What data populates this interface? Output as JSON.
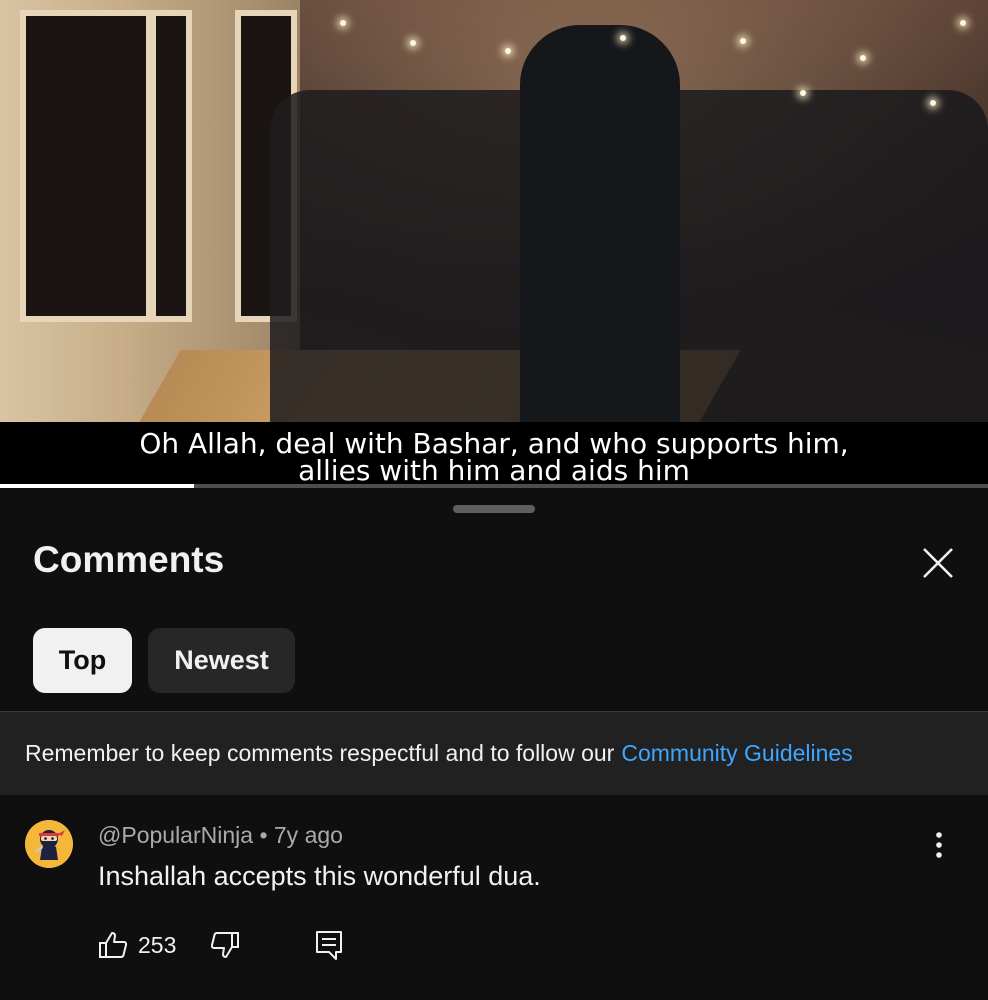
{
  "video": {
    "subtitle_line1": "Oh Allah, deal with Bashar, and who supports him,",
    "subtitle_line2": "allies with him and aids him",
    "progress_fraction": 0.196
  },
  "comments_panel": {
    "title": "Comments",
    "close_icon": "close-icon",
    "sort_chips": [
      {
        "label": "Top",
        "selected": true
      },
      {
        "label": "Newest",
        "selected": false
      }
    ],
    "guidelines_text": "Remember to keep comments respectful and to follow our",
    "guidelines_link": "Community Guidelines",
    "accent_color": "#3ea6ff"
  },
  "comments": [
    {
      "author": "@PopularNinja",
      "separator": "•",
      "age": "7y ago",
      "text": "Inshallah accepts this wonderful dua.",
      "likes": "253",
      "avatar_icon": "ninja-avatar"
    }
  ]
}
